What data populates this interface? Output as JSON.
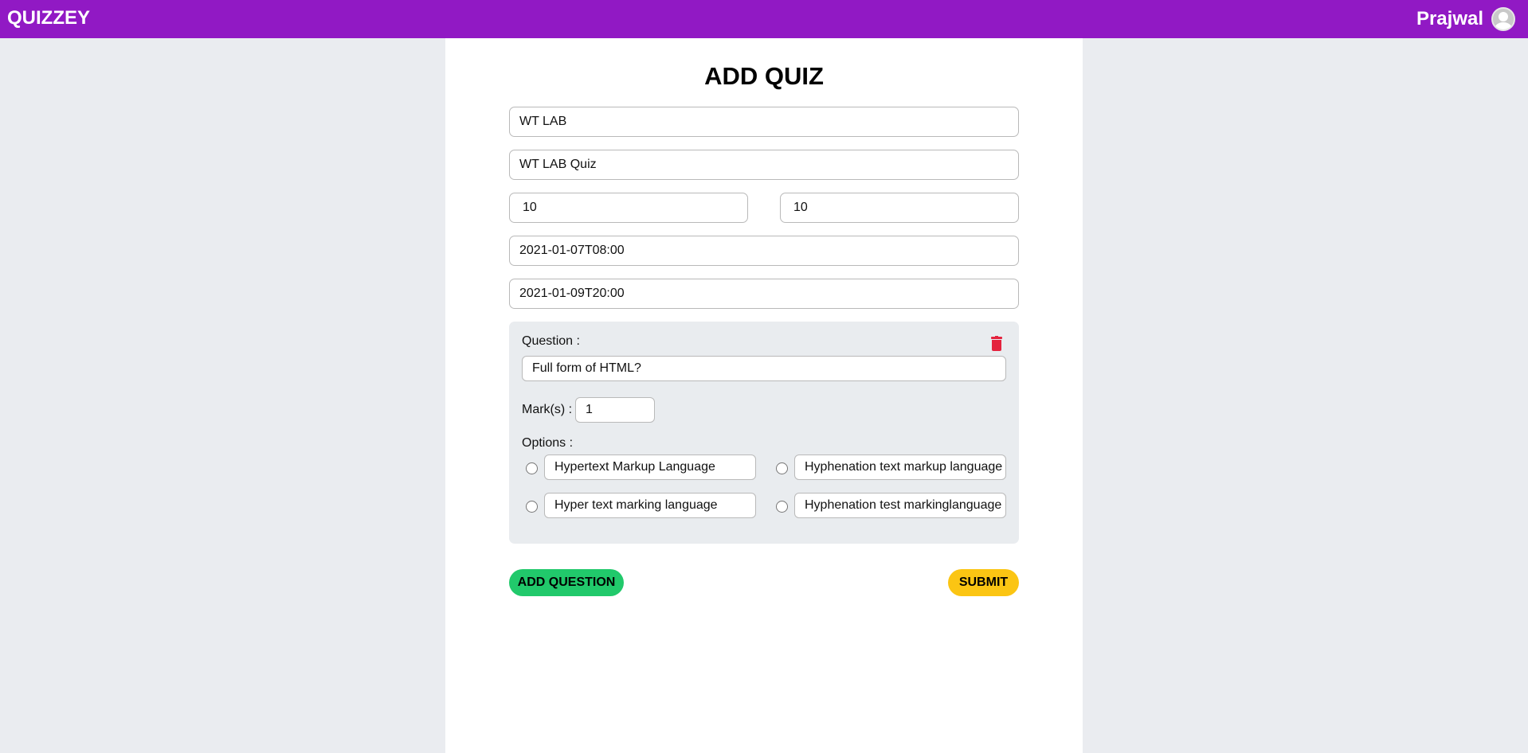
{
  "navbar": {
    "brand": "QUIZZEY",
    "user_name": "Prajwal",
    "color": "#9119c4"
  },
  "page": {
    "title": "ADD QUIZ"
  },
  "form": {
    "subject": "WT LAB",
    "quiz_name": "WT LAB Quiz",
    "field_a": "10",
    "field_b": "10",
    "start_time": "2021-01-07T08:00",
    "end_time": "2021-01-09T20:00"
  },
  "question": {
    "label": "Question :",
    "text": "Full form of HTML?",
    "marks_label": "Mark(s) :",
    "marks": "1",
    "options_label": "Options :",
    "options": [
      "Hypertext Markup Language",
      "Hyphenation text markup language",
      "Hyper text marking language",
      "Hyphenation test markinglanguage"
    ],
    "delete_icon": "trash-icon",
    "delete_color": "#e4233e"
  },
  "buttons": {
    "add_question": "ADD QUESTION",
    "submit": "SUBMIT",
    "add_color": "#21c96b",
    "submit_color": "#fbc513"
  }
}
